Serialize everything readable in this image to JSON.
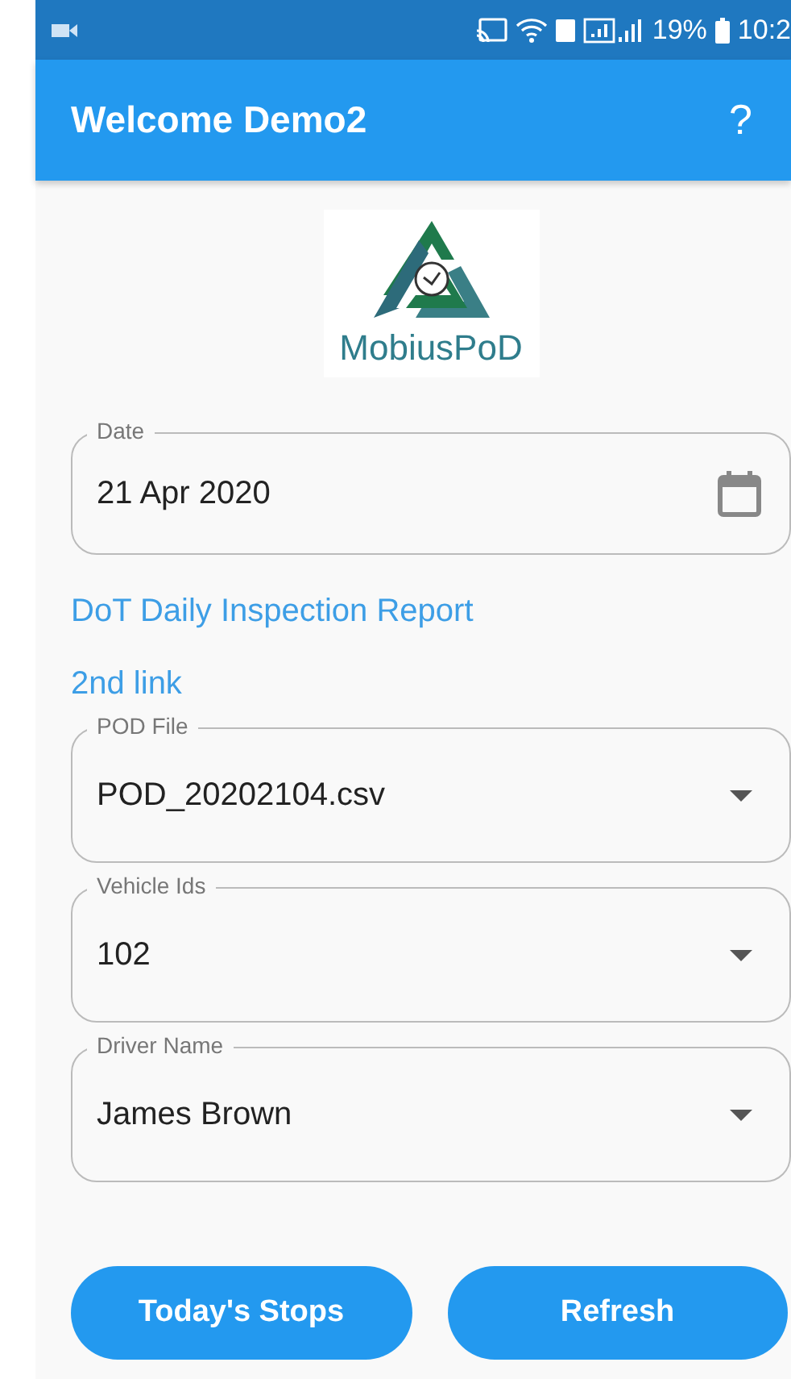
{
  "status_bar": {
    "battery": "19%",
    "time": "10:2"
  },
  "app_bar": {
    "title": "Welcome Demo2",
    "help": "?"
  },
  "logo": {
    "text": "MobiusPoD"
  },
  "date_field": {
    "label": "Date",
    "value": "21 Apr 2020"
  },
  "links": [
    "DoT Daily Inspection Report",
    "2nd link"
  ],
  "dropdowns": [
    {
      "label": "POD File",
      "value": "POD_20202104.csv"
    },
    {
      "label": "Vehicle Ids",
      "value": "102"
    },
    {
      "label": "Driver Name",
      "value": "James Brown"
    }
  ],
  "buttons": [
    "Today's Stops",
    "Refresh"
  ]
}
